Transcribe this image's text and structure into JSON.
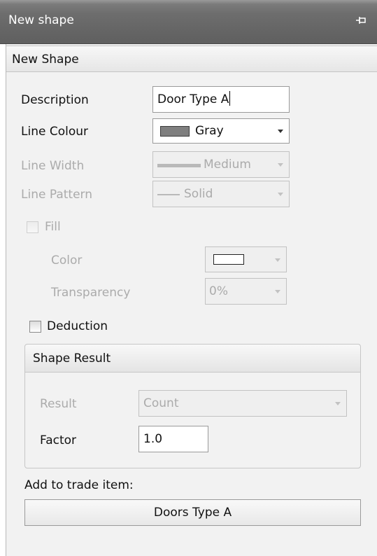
{
  "window": {
    "title": "New shape"
  },
  "panel": {
    "header": "New Shape"
  },
  "fields": {
    "description": {
      "label": "Description",
      "value": "Door Type A"
    },
    "line_colour": {
      "label": "Line Colour",
      "value": "Gray",
      "swatch_color": "#7f7f7f"
    },
    "line_width": {
      "label": "Line Width",
      "value": "Medium"
    },
    "line_pattern": {
      "label": "Line Pattern",
      "value": "Solid"
    },
    "fill": {
      "label": "Fill",
      "checked": false
    },
    "color": {
      "label": "Color"
    },
    "transparency": {
      "label": "Transparency",
      "value": "0%"
    },
    "deduction": {
      "label": "Deduction",
      "checked": false
    }
  },
  "shape_result": {
    "header": "Shape Result",
    "result": {
      "label": "Result",
      "value": "Count"
    },
    "factor": {
      "label": "Factor",
      "value": "1.0"
    }
  },
  "trade": {
    "label": "Add to trade item:",
    "button": "Doors Type A"
  },
  "icons": {
    "pin": "pin-icon",
    "dropdown": "chevron-down-icon"
  },
  "colors": {
    "titlebar": "#6d6d6d",
    "panel_background": "#f2f2f2",
    "disabled_text": "#ababab"
  }
}
